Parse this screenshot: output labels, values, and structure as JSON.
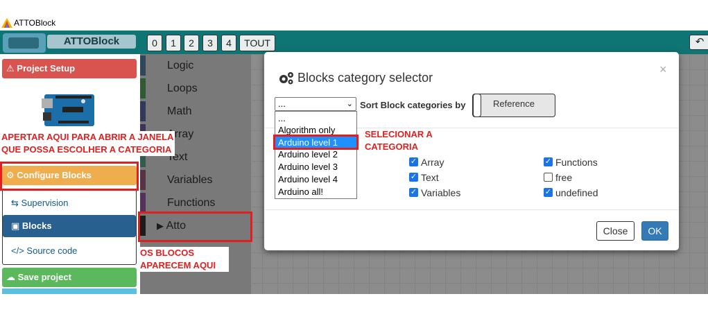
{
  "window": {
    "title": "ATTOBlock"
  },
  "topbar": {
    "brand": "ATTOBlock",
    "level_buttons": [
      "0",
      "1",
      "2",
      "3",
      "4",
      "TOUT"
    ],
    "undo_icon": "undo-icon"
  },
  "sidebar": {
    "project_setup": "Project Setup",
    "configure_blocks": "Configure Blocks",
    "supervision": "Supervision",
    "blocks": "Blocks",
    "source_code": "Source code",
    "save_project": "Save project"
  },
  "toolbox": {
    "categories": [
      {
        "label": "Logic",
        "color": "#5b80a5"
      },
      {
        "label": "Loops",
        "color": "#5ba55b"
      },
      {
        "label": "Math",
        "color": "#5b67a5"
      },
      {
        "label": "Array",
        "color": "#745ba5"
      },
      {
        "label": "Text",
        "color": "#5ba58c"
      },
      {
        "label": "Variables",
        "color": "#a55b80"
      },
      {
        "label": "Functions",
        "color": "#995ba5"
      },
      {
        "label": "Atto",
        "color": "#333333"
      }
    ]
  },
  "modal": {
    "title": "Blocks category selector",
    "close_symbol": "×",
    "select_value": "...",
    "sort_label": "Sort Block categories by",
    "reference_label": "Reference",
    "dropdown_options": [
      "...",
      "Algorithm only",
      "Arduino level 1",
      "Arduino level 2",
      "Arduino level 3",
      "Arduino level 4",
      "Arduino all!"
    ],
    "selected_option": "Arduino level 1",
    "checkboxes": [
      {
        "label": "Array",
        "checked": true
      },
      {
        "label": "Text",
        "checked": true
      },
      {
        "label": "Variables",
        "checked": true
      },
      {
        "label": "Functions",
        "checked": true
      },
      {
        "label": "free",
        "checked": false
      },
      {
        "label": "undefined",
        "checked": true
      }
    ],
    "close_button": "Close",
    "ok_button": "OK"
  },
  "annotations": {
    "configure_note_line1": "APERTAR AQUI PARA ABRIR A JANELA",
    "configure_note_line2": "QUE POSSA ESCOLHER A CATEGORIA",
    "select_note_line1": "SELECIONAR A",
    "select_note_line2": "CATEGORIA",
    "blocks_note_line1": "OS BLOCOS",
    "blocks_note_line2": "APARECEM AQUI"
  },
  "colors": {
    "topbar": "#0f7574",
    "project_setup": "#d9534f",
    "configure_blocks": "#f0ad4e",
    "blocks_active": "#286090",
    "save_project": "#5cb85c",
    "annotation_red": "#e02020",
    "ok_button": "#337ab7"
  }
}
